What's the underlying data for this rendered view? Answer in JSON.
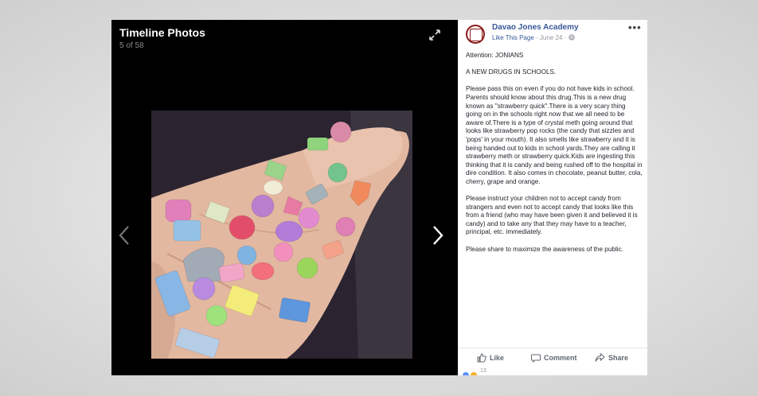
{
  "viewer": {
    "title": "Timeline Photos",
    "counter": "5 of 58"
  },
  "page": {
    "name": "Davao Jones Academy",
    "like_page": "Like This Page",
    "date": "· June 24 ·"
  },
  "post": {
    "paragraphs": [
      "Attention: JONIANS",
      "A NEW DRUGS IN SCHOOLS.",
      "Please pass this on even if you do not have kids in school. Parents should know about this drug.This is a new drug known as \"strawberry quick\".There is a very scary thing going on in the schools right now that we all need to be aware of.There is a type of crystal meth going around that looks like strawberry pop rocks (the candy that sizzles and 'pops' in your mouth). It also smells like strawberry and it is being handed out to kids in school yards.They are calling it strawberry meth or strawberry quick.Kids are ingesting this thinking that it is candy and being rushed off to the hospital in dire condition. It also comes in chocolate, peanut butter, cola, cherry, grape and orange.",
      "Please instruct your children not to accept candy from strangers and even not to accept candy that looks like this from a friend (who may have been given it and believed it is candy) and to take any that they may have to a teacher, principal, etc. immediately.",
      "Please share to maximize the awareness of the public."
    ]
  },
  "actions": {
    "like": "Like",
    "comment": "Comment",
    "share": "Share"
  },
  "reactions": {
    "count": "13"
  },
  "colors": {
    "link": "#385898",
    "avatar_ring": "#8b1a1a"
  },
  "icons": [
    "expand-icon",
    "chevron-left-icon",
    "chevron-right-icon",
    "more-icon",
    "globe-icon",
    "like-icon",
    "comment-icon",
    "share-icon"
  ]
}
